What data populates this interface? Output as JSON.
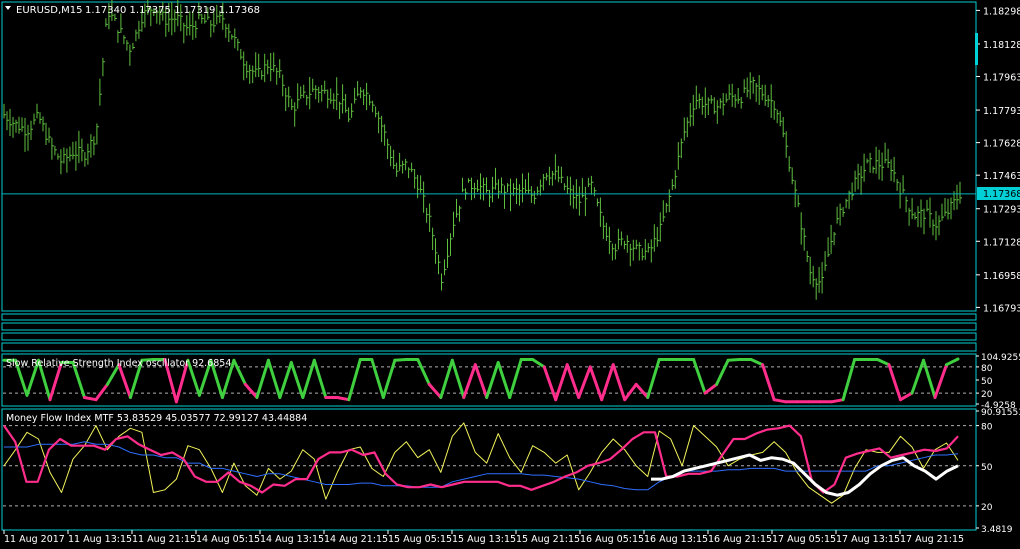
{
  "symbol_header": {
    "symbol": "EURUSD,M15",
    "ohlc": "1.17340 1.17375 1.17319 1.17368"
  },
  "colors": {
    "background": "#000000",
    "frame": "#00cfd6",
    "text": "#ffffff",
    "bars": "#5fbf3f",
    "rsi_high": "#3fcf3f",
    "rsi_low": "#ff2d8c",
    "mfi_pink": "#ff2d8c",
    "mfi_yellow": "#f2f25a",
    "mfi_blue": "#2f6fff",
    "mfi_white": "#ffffff",
    "level_line": "#b0b0b0",
    "price_marker": "#00d0d8"
  },
  "price_axis": {
    "ticks": [
      "1.18298",
      "1.18128",
      "1.17963",
      "1.17793",
      "1.17628",
      "1.17463",
      "1.17293",
      "1.17128",
      "1.16958",
      "1.16793"
    ],
    "current_label": "1.17368",
    "range": [
      1.1679,
      1.183
    ]
  },
  "time_axis": {
    "ticks": [
      "11 Aug 2017",
      "11 Aug 13:15",
      "11 Aug 21:15",
      "14 Aug 05:15",
      "14 Aug 13:15",
      "14 Aug 21:15",
      "15 Aug 05:15",
      "15 Aug 13:15",
      "15 Aug 21:15",
      "16 Aug 05:15",
      "16 Aug 13:15",
      "16 Aug 21:15",
      "17 Aug 05:15",
      "17 Aug 13:15",
      "17 Aug 21:15"
    ]
  },
  "rsi_panel": {
    "title": "Slow Relative Strength Index oscillator 92.6854",
    "axis_labels": [
      "104.9255",
      "80",
      "50",
      "20",
      "-4.9258"
    ],
    "levels": [
      80,
      20
    ],
    "range": [
      -4.9258,
      104.9255
    ]
  },
  "mfi_panel": {
    "title": "Money Flow Index MTF 53.83529 45.03577 72.99127 43.44884",
    "axis_labels": [
      "90.91553",
      "80",
      "50",
      "20",
      "3.4819"
    ],
    "levels": [
      80,
      50,
      20
    ],
    "range": [
      3.4819,
      90.91553
    ]
  },
  "chart_data": {
    "type": "line",
    "price": {
      "series": [
        {
          "name": "EURUSD,M15",
          "values": [
            1.1777,
            1.1772,
            1.1769,
            1.1776,
            1.1762,
            1.1753,
            1.1758,
            1.1757,
            1.1767,
            1.183,
            1.182,
            1.181,
            1.1827,
            1.1832,
            1.1825,
            1.1826,
            1.182,
            1.1825,
            1.1823,
            1.1826,
            1.1815,
            1.1802,
            1.1797,
            1.1803,
            1.1796,
            1.178,
            1.1786,
            1.179,
            1.1788,
            1.1786,
            1.1775,
            1.1791,
            1.1784,
            1.1768,
            1.1748,
            1.1752,
            1.1741,
            1.1722,
            1.1694,
            1.1722,
            1.174,
            1.1742,
            1.1737,
            1.174,
            1.1738,
            1.1738,
            1.1736,
            1.1748,
            1.1746,
            1.1738,
            1.1733,
            1.1741,
            1.1721,
            1.171,
            1.1714,
            1.1708,
            1.1707,
            1.1719,
            1.174,
            1.1767,
            1.1785,
            1.1782,
            1.1781,
            1.1786,
            1.1786,
            1.1792,
            1.1787,
            1.1782,
            1.1758,
            1.1728,
            1.1697,
            1.1691,
            1.1718,
            1.1732,
            1.1743,
            1.1752,
            1.1752,
            1.1751,
            1.1737,
            1.1726,
            1.1727,
            1.1721,
            1.1728,
            1.1737
          ]
        }
      ]
    },
    "rsi": {
      "series": [
        {
          "name": "Slow Relative Strength Index oscillator",
          "values": [
            95,
            95,
            15,
            95,
            5,
            90,
            90,
            10,
            5,
            40,
            85,
            10,
            95,
            97,
            97,
            0,
            95,
            15,
            95,
            10,
            95,
            40,
            10,
            95,
            10,
            90,
            10,
            95,
            10,
            10,
            5,
            97,
            97,
            10,
            95,
            97,
            97,
            40,
            10,
            95,
            10,
            85,
            10,
            90,
            10,
            97,
            97,
            80,
            5,
            85,
            10,
            80,
            5,
            85,
            5,
            40,
            10,
            97,
            97,
            97,
            97,
            20,
            40,
            95,
            97,
            97,
            85,
            5,
            0,
            0,
            0,
            0,
            0,
            5,
            97,
            97,
            97,
            85,
            5,
            20,
            95,
            10,
            85,
            98
          ]
        }
      ]
    },
    "mfi": {
      "series": [
        {
          "name": "pink",
          "values": [
            80,
            68,
            38,
            38,
            62,
            70,
            65,
            65,
            65,
            62,
            70,
            72,
            66,
            62,
            58,
            60,
            55,
            42,
            38,
            38,
            45,
            38,
            35,
            30,
            36,
            35,
            40,
            40,
            55,
            60,
            60,
            62,
            58,
            60,
            44,
            36,
            34,
            34,
            36,
            34,
            36,
            38,
            38,
            38,
            38,
            35,
            35,
            32,
            35,
            38,
            42,
            45,
            50,
            52,
            55,
            62,
            70,
            75,
            75,
            42,
            42,
            44,
            44,
            46,
            58,
            70,
            70,
            74,
            77,
            78,
            80,
            72,
            38,
            30,
            36,
            56,
            59,
            61,
            63,
            56,
            58,
            60,
            62,
            61,
            63,
            72
          ]
        },
        {
          "name": "yellow",
          "values": [
            50,
            62,
            75,
            70,
            45,
            30,
            55,
            65,
            80,
            62,
            72,
            78,
            75,
            30,
            32,
            40,
            65,
            62,
            48,
            30,
            52,
            35,
            28,
            48,
            40,
            46,
            62,
            55,
            25,
            45,
            62,
            64,
            48,
            42,
            60,
            68,
            56,
            62,
            45,
            72,
            82,
            60,
            52,
            74,
            56,
            45,
            65,
            60,
            52,
            58,
            32,
            45,
            60,
            70,
            62,
            50,
            42,
            76,
            70,
            50,
            80,
            72,
            64,
            50,
            55,
            58,
            60,
            68,
            60,
            45,
            34,
            28,
            22,
            28,
            48,
            62,
            60,
            60,
            72,
            64,
            48,
            62,
            67,
            54
          ]
        },
        {
          "name": "blue",
          "values": [
            64,
            64,
            64,
            66,
            66,
            66,
            66,
            68,
            66,
            66,
            64,
            60,
            58,
            58,
            56,
            56,
            52,
            52,
            48,
            48,
            46,
            44,
            42,
            44,
            44,
            42,
            40,
            38,
            36,
            36,
            36,
            37,
            37,
            35,
            35,
            35,
            34,
            34,
            34,
            38,
            40,
            42,
            44,
            44,
            44,
            44,
            43,
            43,
            42,
            41,
            40,
            38,
            36,
            35,
            33,
            32,
            32,
            38,
            42,
            46,
            46,
            46,
            46,
            47,
            47,
            48,
            48,
            48,
            46,
            46,
            46,
            46,
            46,
            46,
            46,
            46,
            50,
            50,
            52,
            54,
            56,
            58,
            58,
            59
          ]
        },
        {
          "name": "white",
          "values": [
            null,
            null,
            null,
            null,
            null,
            null,
            null,
            null,
            null,
            null,
            null,
            null,
            null,
            null,
            null,
            null,
            null,
            null,
            null,
            null,
            null,
            null,
            null,
            null,
            null,
            null,
            null,
            null,
            null,
            null,
            null,
            null,
            null,
            null,
            null,
            null,
            null,
            null,
            null,
            null,
            null,
            null,
            null,
            null,
            null,
            null,
            null,
            null,
            null,
            null,
            null,
            null,
            null,
            null,
            null,
            null,
            null,
            null,
            null,
            40,
            40,
            42,
            46,
            48,
            50,
            52,
            54,
            56,
            58,
            54,
            56,
            55,
            52,
            44,
            36,
            30,
            28,
            30,
            36,
            44,
            50,
            54,
            56,
            50,
            46,
            40,
            46,
            50
          ]
        }
      ]
    }
  }
}
